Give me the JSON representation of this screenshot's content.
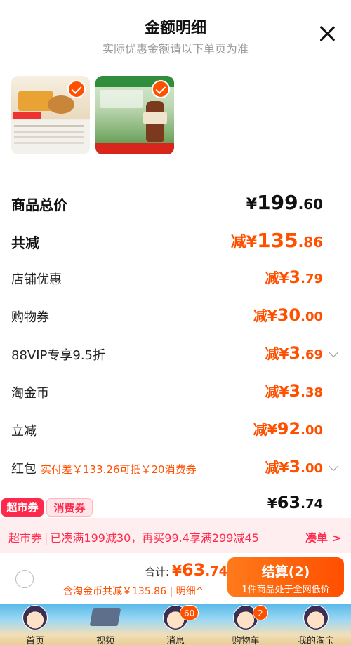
{
  "header": {
    "title": "金额明细",
    "subtitle": "实际优惠金额请以下单页为准"
  },
  "products": [
    {
      "name": "product-1",
      "selected": true
    },
    {
      "name": "product-2",
      "selected": true
    }
  ],
  "rows": {
    "total": {
      "label": "商品总价",
      "currency": "¥",
      "int": "199",
      "dec": ".60"
    },
    "reduce_total": {
      "label": "共减",
      "prefix": "减",
      "currency": "¥",
      "int": "135",
      "dec": ".86"
    },
    "shop": {
      "label": "店铺优惠",
      "prefix": "减",
      "currency": "¥",
      "int": "3",
      "dec": ".79"
    },
    "voucher": {
      "label": "购物券",
      "prefix": "减",
      "currency": "¥",
      "int": "30",
      "dec": ".00"
    },
    "vip": {
      "label": "88VIP专享9.5折",
      "prefix": "减",
      "currency": "¥",
      "int": "3",
      "dec": ".69"
    },
    "coin": {
      "label": "淘金币",
      "prefix": "减",
      "currency": "¥",
      "int": "3",
      "dec": ".38"
    },
    "instant": {
      "label": "立减",
      "prefix": "减",
      "currency": "¥",
      "int": "92",
      "dec": ".00"
    },
    "redpack": {
      "label": "红包",
      "note": "实付差￥133.26可抵￥20消费券",
      "prefix": "减",
      "currency": "¥",
      "int": "3",
      "dec": ".00"
    },
    "pay": {
      "currency": "¥",
      "int": "63",
      "dec": ".74"
    }
  },
  "coupon_tabs": {
    "tab1": "超市券",
    "tab2": "消费券"
  },
  "promo": {
    "tag": "超市券",
    "sep": "|",
    "text": "已凑满199减30，再买99.4享满299减45",
    "link": "凑单 >"
  },
  "checkout": {
    "total_label": "合计:",
    "currency": "¥",
    "int": "63",
    "dec": ".74",
    "discount_text": "含淘金币共减￥135.86",
    "sep": "|",
    "detail": "明细^",
    "pay_button": "结算(2)",
    "pay_sub": "1件商品处于全网低价"
  },
  "tabbar": [
    {
      "label": "首页"
    },
    {
      "label": "视频"
    },
    {
      "label": "消息",
      "badge": "60"
    },
    {
      "label": "购物车",
      "badge": "2"
    },
    {
      "label": "我的淘宝"
    }
  ],
  "colors": {
    "accent": "#ff5000",
    "coupon": "#ff2a4b"
  },
  "icons": {
    "close": "close-icon",
    "check": "check-icon",
    "chevron": "chevron-down-icon"
  }
}
